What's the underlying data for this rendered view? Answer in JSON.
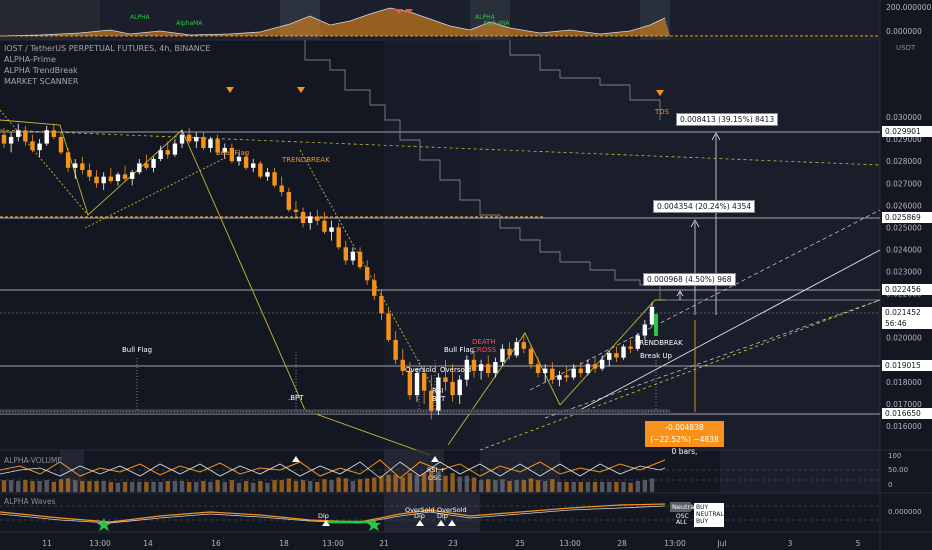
{
  "header": {
    "symbol_line": "IOST / TetherUS PERPETUAL FUTURES, 4h, BINANCE",
    "indicators": [
      "ALPHA-Prime",
      "ALPHA TrendBreak",
      "MARKET SCANNER"
    ],
    "currency": "USDT"
  },
  "top_strip": {
    "labels": [
      "ALPHA",
      "AlphaMA",
      "ALPHA",
      "AlphaMA"
    ],
    "axis": [
      "200.000000",
      "0.000000"
    ]
  },
  "chart_data": {
    "type": "candlestick",
    "x_ticks": [
      "11",
      "13:00",
      "14",
      "16",
      "18",
      "13:00",
      "21",
      "23",
      "25",
      "13:00",
      "28",
      "13:00",
      "Jul",
      "3",
      "5"
    ],
    "y_ticks": [
      0.03,
      0.029,
      0.028,
      0.027,
      0.026,
      0.025,
      0.024,
      0.023,
      0.022,
      0.021,
      0.02,
      0.018,
      0.017,
      0.016
    ],
    "price_tags": [
      "0.029901",
      "0.025869",
      "0.022456",
      "0.021452",
      "0.019015",
      "0.016650"
    ],
    "countdown": "56:46",
    "last_price": 0.021452,
    "ohlc": [
      [
        0.0292,
        0.0295,
        0.0286,
        0.0288
      ],
      [
        0.0288,
        0.0293,
        0.0284,
        0.0291
      ],
      [
        0.0291,
        0.0297,
        0.0289,
        0.0294
      ],
      [
        0.0294,
        0.0296,
        0.0287,
        0.0289
      ],
      [
        0.0289,
        0.0292,
        0.0284,
        0.0285
      ],
      [
        0.0285,
        0.029,
        0.0282,
        0.0288
      ],
      [
        0.0288,
        0.0296,
        0.0287,
        0.0294
      ],
      [
        0.0294,
        0.0297,
        0.029,
        0.0291
      ],
      [
        0.0291,
        0.0293,
        0.0283,
        0.0284
      ],
      [
        0.0284,
        0.0286,
        0.0275,
        0.0277
      ],
      [
        0.0277,
        0.0281,
        0.0272,
        0.0279
      ],
      [
        0.0279,
        0.0282,
        0.0274,
        0.0276
      ],
      [
        0.0276,
        0.0279,
        0.0271,
        0.0273
      ],
      [
        0.0273,
        0.0276,
        0.0268,
        0.027
      ],
      [
        0.027,
        0.0275,
        0.0267,
        0.0273
      ],
      [
        0.0273,
        0.0277,
        0.027,
        0.0271
      ],
      [
        0.0271,
        0.0275,
        0.0269,
        0.0274
      ],
      [
        0.0274,
        0.0278,
        0.0271,
        0.0272
      ],
      [
        0.0272,
        0.0276,
        0.0269,
        0.0275
      ],
      [
        0.0275,
        0.0281,
        0.0274,
        0.0279
      ],
      [
        0.0279,
        0.0283,
        0.0276,
        0.0277
      ],
      [
        0.0277,
        0.0282,
        0.0275,
        0.0281
      ],
      [
        0.0281,
        0.0287,
        0.028,
        0.0285
      ],
      [
        0.0285,
        0.0289,
        0.0281,
        0.0283
      ],
      [
        0.0283,
        0.029,
        0.0282,
        0.0288
      ],
      [
        0.0288,
        0.0294,
        0.0286,
        0.0292
      ],
      [
        0.0292,
        0.0295,
        0.0288,
        0.0289
      ],
      [
        0.0289,
        0.0293,
        0.0286,
        0.0291
      ],
      [
        0.0291,
        0.0293,
        0.0285,
        0.0286
      ],
      [
        0.0286,
        0.0291,
        0.0284,
        0.029
      ],
      [
        0.029,
        0.0292,
        0.0283,
        0.0284
      ],
      [
        0.0284,
        0.0288,
        0.0281,
        0.0286
      ],
      [
        0.0286,
        0.0288,
        0.0279,
        0.028
      ],
      [
        0.028,
        0.0284,
        0.0278,
        0.0282
      ],
      [
        0.0282,
        0.0284,
        0.0276,
        0.0277
      ],
      [
        0.0277,
        0.0281,
        0.0275,
        0.0279
      ],
      [
        0.0279,
        0.028,
        0.0272,
        0.0273
      ],
      [
        0.0273,
        0.0277,
        0.0271,
        0.0275
      ],
      [
        0.0275,
        0.0277,
        0.0268,
        0.0269
      ],
      [
        0.0269,
        0.0273,
        0.0264,
        0.0266
      ],
      [
        0.0266,
        0.0268,
        0.0257,
        0.0258
      ],
      [
        0.0258,
        0.0262,
        0.0254,
        0.0257
      ],
      [
        0.0257,
        0.0259,
        0.025,
        0.0252
      ],
      [
        0.0252,
        0.0257,
        0.0249,
        0.0255
      ],
      [
        0.0255,
        0.0258,
        0.0251,
        0.0253
      ],
      [
        0.0253,
        0.0257,
        0.0247,
        0.0248
      ],
      [
        0.0248,
        0.0253,
        0.0244,
        0.025
      ],
      [
        0.025,
        0.0252,
        0.024,
        0.0241
      ],
      [
        0.0241,
        0.0244,
        0.0233,
        0.0235
      ],
      [
        0.0235,
        0.0241,
        0.0233,
        0.0239
      ],
      [
        0.0239,
        0.0241,
        0.0231,
        0.0232
      ],
      [
        0.0232,
        0.0235,
        0.0224,
        0.0226
      ],
      [
        0.0226,
        0.0229,
        0.0217,
        0.0219
      ],
      [
        0.0219,
        0.0222,
        0.0208,
        0.0211
      ],
      [
        0.0211,
        0.0213,
        0.0198,
        0.0199
      ],
      [
        0.0199,
        0.0203,
        0.0188,
        0.019
      ],
      [
        0.019,
        0.0195,
        0.0183,
        0.0185
      ],
      [
        0.0185,
        0.0189,
        0.0172,
        0.0174
      ],
      [
        0.0174,
        0.0186,
        0.0171,
        0.0184
      ],
      [
        0.0184,
        0.0187,
        0.017,
        0.0176
      ],
      [
        0.0176,
        0.0183,
        0.0163,
        0.0167
      ],
      [
        0.0167,
        0.0184,
        0.0165,
        0.0182
      ],
      [
        0.0182,
        0.019,
        0.0176,
        0.018
      ],
      [
        0.018,
        0.0188,
        0.0171,
        0.0174
      ],
      [
        0.0174,
        0.0183,
        0.017,
        0.0181
      ],
      [
        0.0181,
        0.0192,
        0.0178,
        0.019
      ],
      [
        0.019,
        0.0194,
        0.0182,
        0.0185
      ],
      [
        0.0185,
        0.019,
        0.0181,
        0.0188
      ],
      [
        0.0188,
        0.0192,
        0.0182,
        0.0184
      ],
      [
        0.0184,
        0.0191,
        0.0182,
        0.0189
      ],
      [
        0.0189,
        0.0197,
        0.0187,
        0.0195
      ],
      [
        0.0195,
        0.0198,
        0.019,
        0.0192
      ],
      [
        0.0192,
        0.02,
        0.0191,
        0.0198
      ],
      [
        0.0198,
        0.0202,
        0.0193,
        0.0195
      ],
      [
        0.0195,
        0.0197,
        0.0186,
        0.0188
      ],
      [
        0.0188,
        0.0191,
        0.0182,
        0.0184
      ],
      [
        0.0184,
        0.0188,
        0.018,
        0.0186
      ],
      [
        0.0186,
        0.0189,
        0.0179,
        0.0181
      ],
      [
        0.0181,
        0.0185,
        0.0178,
        0.0183
      ],
      [
        0.0183,
        0.0187,
        0.018,
        0.0182
      ],
      [
        0.0182,
        0.0188,
        0.0181,
        0.0186
      ],
      [
        0.0186,
        0.0189,
        0.0182,
        0.0184
      ],
      [
        0.0184,
        0.019,
        0.0183,
        0.0188
      ],
      [
        0.0188,
        0.0191,
        0.0184,
        0.0186
      ],
      [
        0.0186,
        0.0192,
        0.0185,
        0.019
      ],
      [
        0.019,
        0.0194,
        0.0187,
        0.0193
      ],
      [
        0.0193,
        0.0196,
        0.0189,
        0.0191
      ],
      [
        0.0191,
        0.0197,
        0.019,
        0.0196
      ],
      [
        0.0196,
        0.0199,
        0.0193,
        0.0195
      ],
      [
        0.0195,
        0.0202,
        0.0194,
        0.0201
      ],
      [
        0.0201,
        0.0208,
        0.0199,
        0.0206
      ],
      [
        0.0206,
        0.0216,
        0.0205,
        0.0214
      ]
    ],
    "annotations": [
      "Bear Flag",
      "TRENDBREAK",
      "Bull Flag",
      "Bull Flag",
      "Oversold",
      "Oversold",
      "RSI",
      "BPT",
      "DEATH",
      "CROSS",
      "TRENDBREAK",
      "Break Up",
      "TDS",
      ".BPT"
    ]
  },
  "measurements": {
    "upper": "0.008413 (39.15%) 8413",
    "middle": "0.004354 (20.24%) 4354",
    "lower": "0.000968 (4.50%) 968",
    "negative": "-0.004838 (−22.52%) −4838",
    "bars": "0 bars,"
  },
  "volume_pane": {
    "title": "ALPHA-VOLUME",
    "axis": [
      "100",
      "50.00",
      "0"
    ],
    "labels": [
      "RSI +",
      "OSC"
    ]
  },
  "waves_pane": {
    "title": "ALPHA Waves",
    "axis": [
      "0.000000"
    ],
    "labels": [
      "Dip",
      "OverSold",
      "Dip",
      "OverSold",
      "Dip"
    ],
    "neutral_tag": "Neutral",
    "signals": [
      "BUY",
      "NEUTRAL",
      "BUY"
    ],
    "left_signals": [
      "OSC",
      "ALL"
    ]
  },
  "colors": {
    "background": "#131722",
    "up_candle": "#ffffff",
    "down_candle": "#f7931a",
    "accent_orange": "#f7931a",
    "green": "#26c941",
    "red": "#ef5350"
  }
}
